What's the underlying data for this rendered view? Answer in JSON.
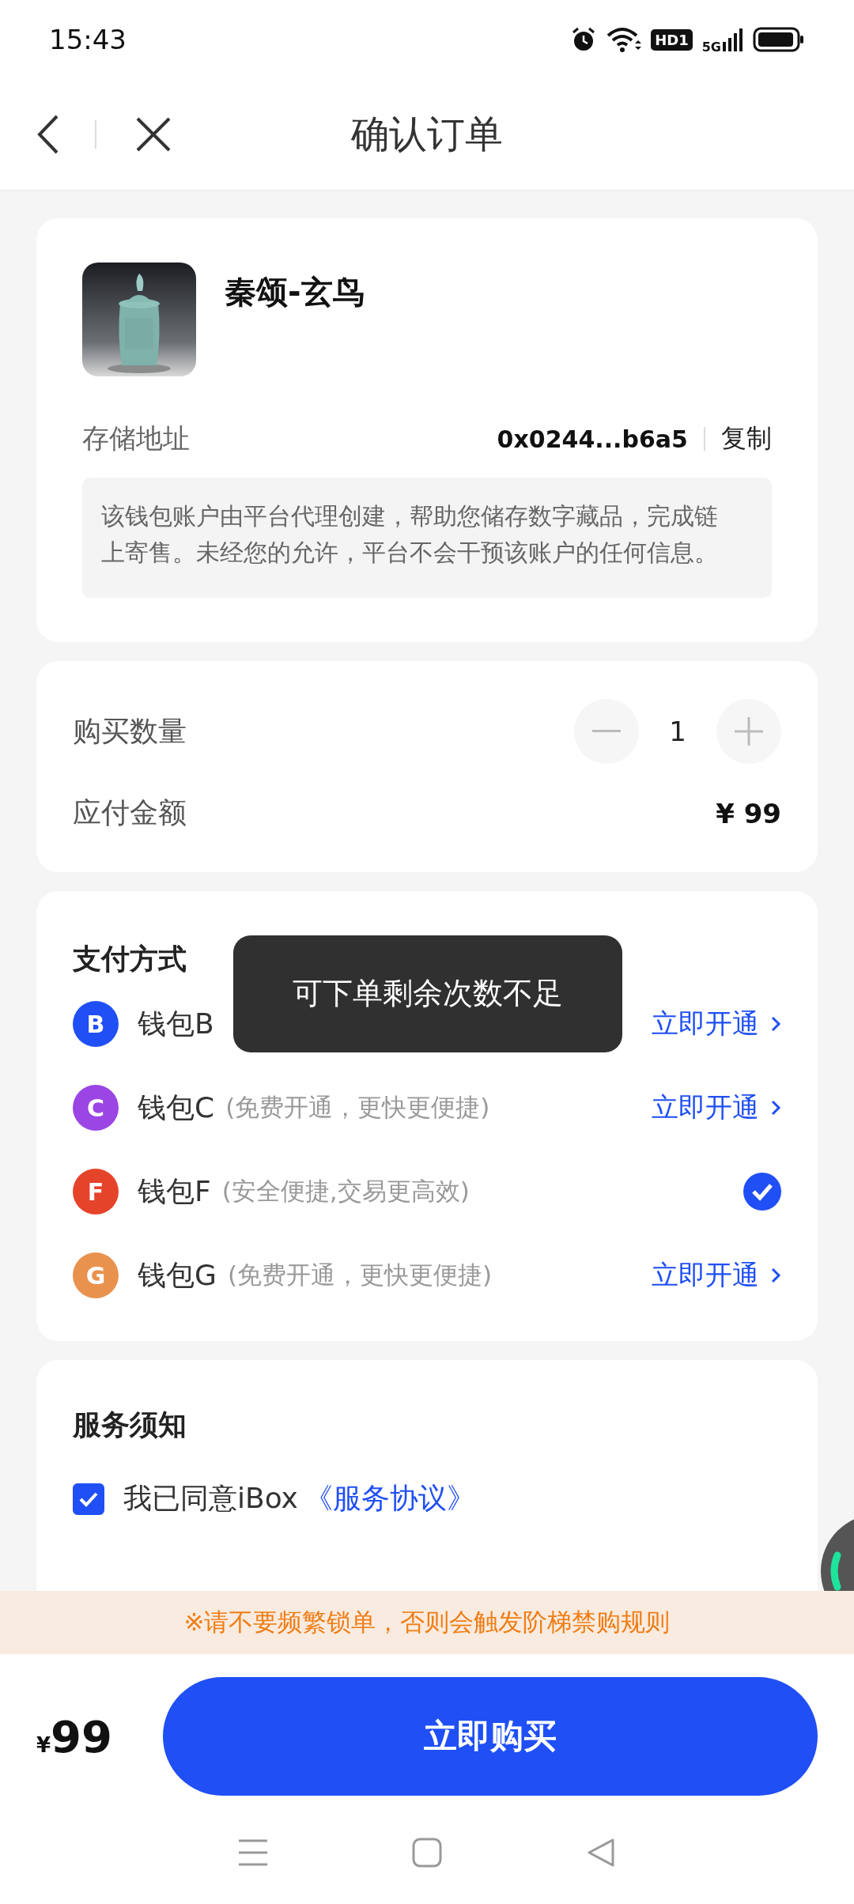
{
  "status_bar": {
    "time": "15:43",
    "hd_label": "HD1",
    "network": "5G"
  },
  "header": {
    "title": "确认订单"
  },
  "product": {
    "name": "秦颂-玄鸟",
    "address_label": "存储地址",
    "address": "0x0244...b6a5",
    "copy": "复制",
    "note": "该钱包账户由平台代理创建，帮助您储存数字藏品，完成链上寄售。未经您的允许，平台不会干预该账户的任何信息。"
  },
  "order": {
    "quantity_label": "购买数量",
    "quantity": "1",
    "amount_label": "应付金额",
    "amount": "¥ 99"
  },
  "payment": {
    "title": "支付方式",
    "methods": [
      {
        "letter": "B",
        "name": "钱包B",
        "color": "#1f4ff5",
        "selected": false,
        "action": "立即开通"
      },
      {
        "letter": "C",
        "name": "钱包C",
        "desc": "(免费开通，更快更便捷)",
        "color": "#9b45e4",
        "selected": false,
        "action": "立即开通"
      },
      {
        "letter": "F",
        "name": "钱包F",
        "desc": "(安全便捷,交易更高效)",
        "color": "#e5432a",
        "selected": true
      },
      {
        "letter": "G",
        "name": "钱包G",
        "desc": "(免费开通，更快更便捷)",
        "color": "#e8924e",
        "selected": false,
        "action": "立即开通"
      }
    ]
  },
  "toast": "可下单剩余次数不足",
  "service": {
    "title": "服务须知",
    "agree_text": "我已同意iBox",
    "agree_link": "《服务协议》",
    "checked": true
  },
  "warning": "※请不要频繁锁单，否则会触发阶梯禁购规则",
  "bottom_bar": {
    "currency": "¥",
    "price": "99",
    "buy_button": "立即购买"
  }
}
